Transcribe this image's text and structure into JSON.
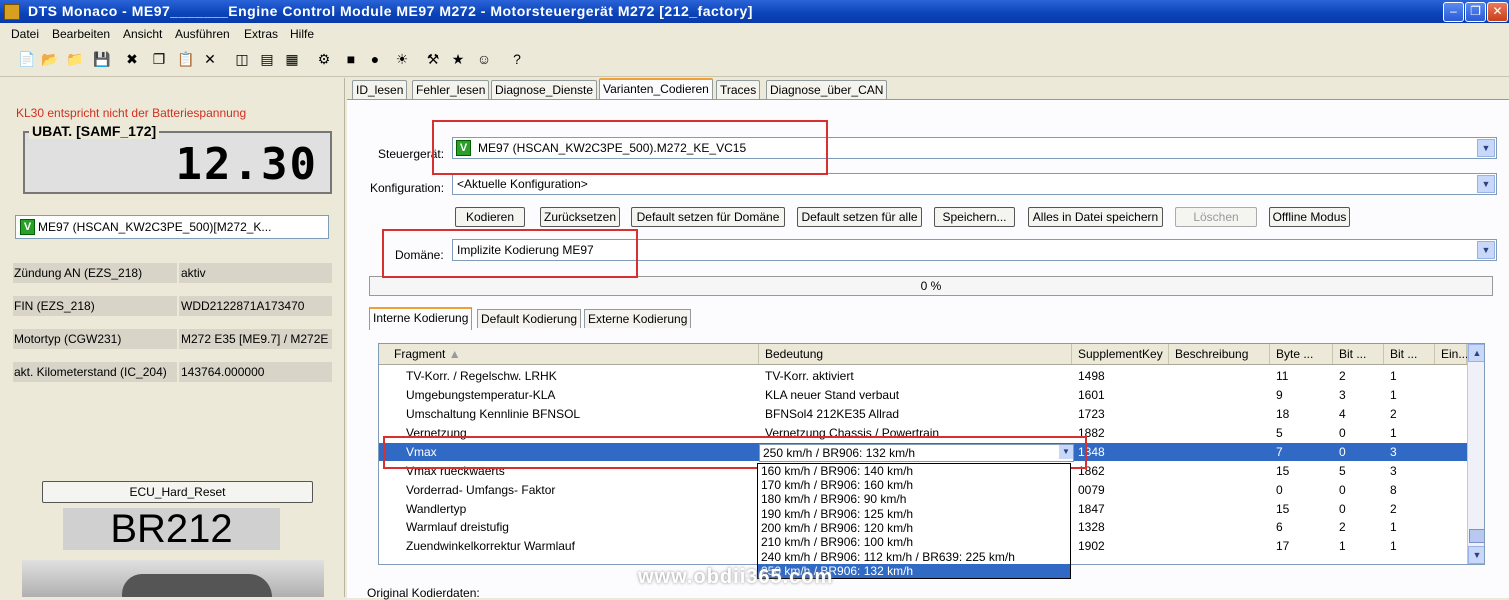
{
  "window": {
    "title": "DTS Monaco  - ME97_______Engine Control Module ME97 M272 - Motorsteuergerät M272 [212_factory]"
  },
  "menu": [
    "Datei",
    "Bearbeiten",
    "Ansicht",
    "Ausführen",
    "Extras",
    "Hilfe"
  ],
  "left": {
    "warning": "KL30 entspricht nicht der Batteriespannung",
    "ubat_label": "UBAT. [SAMF_172]",
    "ubat_value": "12.30",
    "ecu_badge": "V",
    "ecu_name": "ME97 (HSCAN_KW2C3PE_500)[M272_K...",
    "info": [
      {
        "key": "Zündung AN (EZS_218)",
        "value": "aktiv"
      },
      {
        "key": "FIN  (EZS_218)",
        "value": "WDD2122871A173470"
      },
      {
        "key": "Motortyp (CGW231)",
        "value": "M272 E35 [ME9.7] / M272E"
      },
      {
        "key": "akt. Kilometerstand (IC_204)",
        "value": "143764.000000"
      }
    ],
    "reset_button": "ECU_Hard_Reset",
    "model": "BR212"
  },
  "tabs": [
    "ID_lesen",
    "Fehler_lesen",
    "Diagnose_Dienste",
    "Varianten_Codieren",
    "Traces",
    "Diagnose_über_CAN"
  ],
  "form": {
    "steuergeraet_label": "Steuergerät:",
    "steuergeraet_badge": "V",
    "steuergeraet_value": "ME97 (HSCAN_KW2C3PE_500).M272_KE_VC15",
    "konfiguration_label": "Konfiguration:",
    "konfiguration_value": "<Aktuelle Konfiguration>",
    "domaene_label": "Domäne:",
    "domaene_value": "Implizite Kodierung ME97",
    "progress": "0 %"
  },
  "buttons": [
    "Kodieren",
    "Zurücksetzen",
    "Default setzen für Domäne",
    "Default setzen für alle",
    "Speichern...",
    "Alles in Datei speichern",
    "Löschen",
    "Offline Modus"
  ],
  "subtabs": [
    "Interne Kodierung",
    "Default Kodierung",
    "Externe Kodierung"
  ],
  "grid": {
    "columns": [
      "Fragment",
      "Bedeutung",
      "SupplementKey",
      "Beschreibung",
      "Byte ...",
      "Bit ...",
      "Bit ...",
      "Ein..."
    ],
    "rows": [
      [
        "TV-Korr. / Regelschw. LRHK",
        "TV-Korr. aktiviert",
        "1498",
        "",
        "11",
        "2",
        "1"
      ],
      [
        "Umgebungstemperatur-KLA",
        "KLA neuer Stand verbaut",
        "1601",
        "",
        "9",
        "3",
        "1"
      ],
      [
        "Umschaltung Kennlinie BFNSOL",
        "BFNSol4 212KE35 Allrad",
        "1723",
        "",
        "18",
        "4",
        "2"
      ],
      [
        "Vernetzung",
        "Vernetzung Chassis / Powertrain",
        "1882",
        "",
        "5",
        "0",
        "1"
      ],
      [
        "Vmax",
        "250 km/h / BR906: 132 km/h",
        "1348",
        "",
        "7",
        "0",
        "3"
      ],
      [
        "Vmax rueckwaerts",
        "",
        "1862",
        "",
        "15",
        "5",
        "3"
      ],
      [
        "Vorderrad- Umfangs- Faktor",
        "",
        "0079",
        "",
        "0",
        "0",
        "8"
      ],
      [
        "Wandlertyp",
        "",
        "1847",
        "",
        "15",
        "0",
        "2"
      ],
      [
        "Warmlauf dreistufig",
        "",
        "1328",
        "",
        "6",
        "2",
        "1"
      ],
      [
        "Zuendwinkelkorrektur Warmlauf",
        "",
        "1902",
        "",
        "17",
        "1",
        "1"
      ]
    ]
  },
  "dropdown_options": [
    "160 km/h / BR906: 140 km/h",
    "170 km/h / BR906: 160 km/h",
    "180 km/h / BR906: 90 km/h",
    "190 km/h / BR906: 125 km/h",
    "200 km/h / BR906: 120 km/h",
    "210 km/h / BR906: 100 km/h",
    "240 km/h / BR906: 112 km/h / BR639: 225 km/h",
    "250 km/h / BR906: 132 km/h"
  ],
  "original_label": "Original Kodierdaten:",
  "watermark": "www.obdii365.com"
}
